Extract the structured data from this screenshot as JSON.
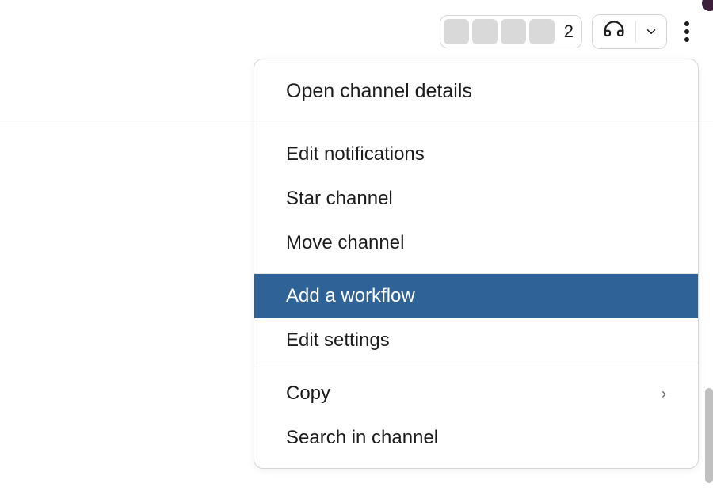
{
  "topbar": {
    "count": "2"
  },
  "menu": {
    "open_details": "Open channel details",
    "edit_notifications": "Edit notifications",
    "star_channel": "Star channel",
    "move_channel": "Move channel",
    "add_workflow": "Add a workflow",
    "edit_settings": "Edit settings",
    "copy": "Copy",
    "submenu_arrow": "›",
    "search_channel": "Search in channel"
  }
}
